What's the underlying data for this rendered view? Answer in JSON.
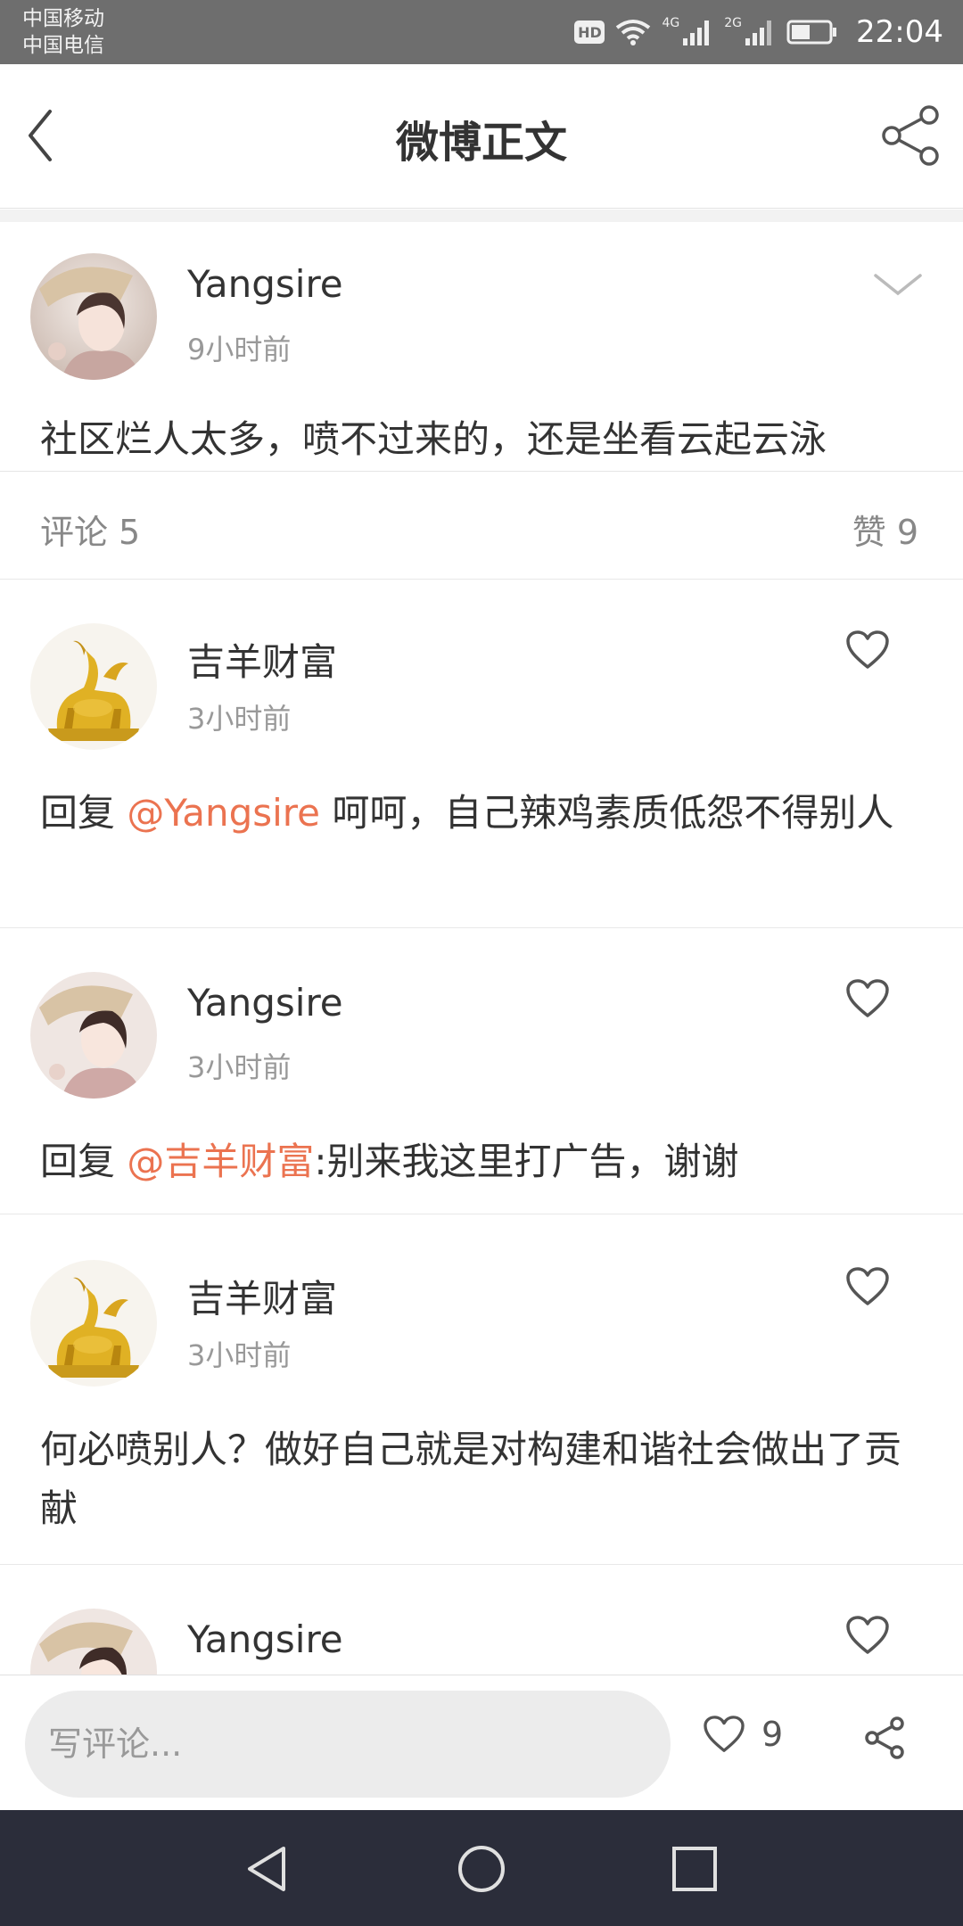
{
  "status_bar": {
    "carrier1": "中国移动",
    "carrier2": "中国电信",
    "hd": "HD",
    "net1": "4G",
    "net2": "2G",
    "time": "22:04"
  },
  "header": {
    "title": "微博正文",
    "back_icon": "chevron-left-icon",
    "share_icon": "share-icon"
  },
  "post": {
    "author": "Yangsire",
    "time": "9小时前",
    "text": "社区烂人太多，喷不过来的，还是坐看云起云泳"
  },
  "stats": {
    "comments_label": "评论",
    "comments_count": "5",
    "likes_label": "赞",
    "likes_count": "9"
  },
  "comments": [
    {
      "author": "吉羊财富",
      "time": "3小时前",
      "prefix": "回复 ",
      "mention": "@Yangsire",
      "text": " 呵呵，自己辣鸡素质低怨不得别人"
    },
    {
      "author": "Yangsire",
      "time": "3小时前",
      "prefix": "回复 ",
      "mention": "@吉羊财富",
      "text": ":别来我这里打广告，谢谢"
    },
    {
      "author": "吉羊财富",
      "time": "3小时前",
      "text": "何必喷别人？做好自己就是对构建和谐社会做出了贡献"
    },
    {
      "author": "Yangsire"
    }
  ],
  "bottom_bar": {
    "input_placeholder": "写评论...",
    "like_count": "9"
  },
  "colors": {
    "mention": "#eb7350",
    "status_bar": "#6e6e6e",
    "nav_bar": "#2b2d3a"
  }
}
